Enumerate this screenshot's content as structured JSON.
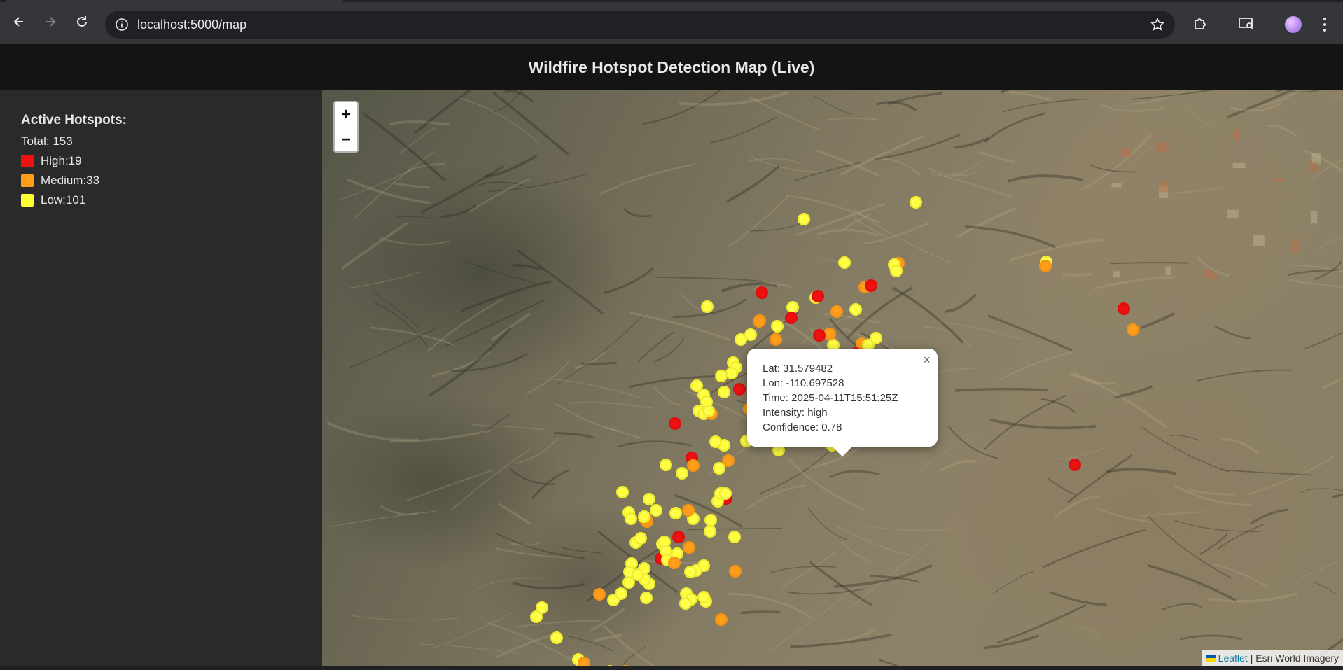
{
  "browser": {
    "url": "localhost:5000/map"
  },
  "app": {
    "title": "Wildfire Hotspot Detection Map (Live)"
  },
  "sidebar": {
    "heading": "Active Hotspots:",
    "total": "Total: 153",
    "legend": [
      {
        "label": "High:19",
        "color": "#ee1111"
      },
      {
        "label": "Medium:33",
        "color": "#ff9e1a"
      },
      {
        "label": "Low:101",
        "color": "#ffff33"
      }
    ]
  },
  "map": {
    "zoom_in": "+",
    "zoom_out": "−",
    "popup": {
      "lat": "Lat: 31.579482",
      "lon": "Lon: -110.697528",
      "time": "Time: 2025-04-11T15:51:25Z",
      "intensity": "Intensity: high",
      "confidence": "Confidence: 0.78",
      "close": "×"
    },
    "attribution": {
      "leaflet": "Leaflet",
      "rest": "| Esri World Imagery"
    }
  }
}
